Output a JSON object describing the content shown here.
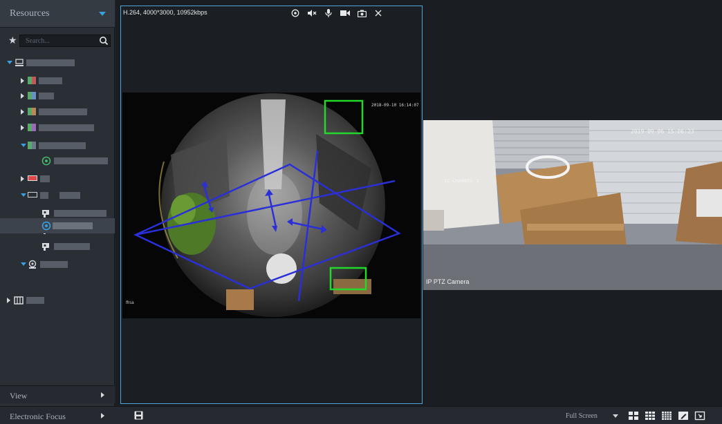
{
  "sidebar": {
    "resources_label": "Resources",
    "search_placeholder": "Search...",
    "view_label": "View",
    "electronic_focus_label": "Electronic Focus"
  },
  "main_view": {
    "stream_info": "H.264, 4000*3000, 10952kbps",
    "fisheye_timestamp": "2018-09-10 16:14:07",
    "toolbar_icons": [
      "target-icon",
      "mute-icon",
      "microphone-icon",
      "record-icon",
      "snapshot-icon",
      "close-icon"
    ]
  },
  "second_view": {
    "camera_name": "IP PTZ Camera",
    "timestamp": "2019-09-06 15:06:23",
    "overlay_label": "IC CHANNEL 1"
  },
  "bottombar": {
    "fullscreen_label": "Full Screen",
    "layout_icons": [
      "layout-4-icon",
      "layout-9-icon",
      "layout-16-icon",
      "custom-layout-icon",
      "fullscreen-icon"
    ]
  },
  "colors": {
    "accent": "#3aa0e0",
    "pane_border": "#4fa6dc",
    "ivs_rule": "#2a2fd8",
    "detection_box": "#22d82a"
  }
}
